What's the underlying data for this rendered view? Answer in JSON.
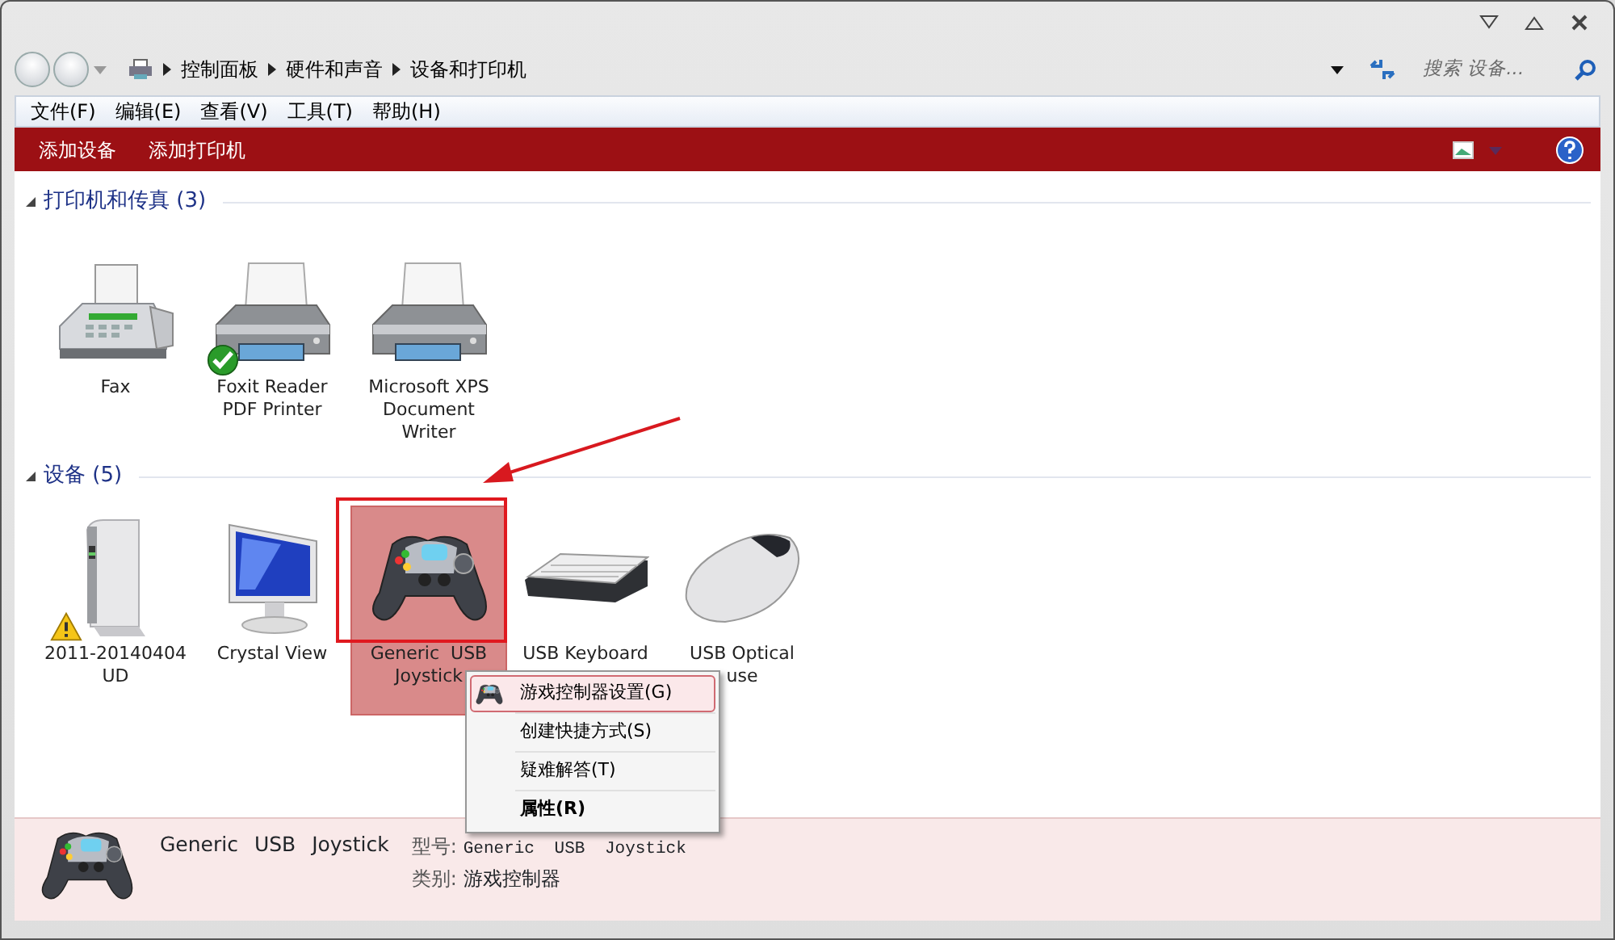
{
  "address": {
    "breadcrumb": [
      "控制面板",
      "硬件和声音",
      "设备和打印机"
    ]
  },
  "search": {
    "placeholder": "搜索 设备..."
  },
  "menu_bar": [
    "文件(F)",
    "编辑(E)",
    "查看(V)",
    "工具(T)",
    "帮助(H)"
  ],
  "command_bar": [
    "添加设备",
    "添加打印机"
  ],
  "groups": [
    {
      "title": "打印机和传真 (3)",
      "expanded": true,
      "items": [
        {
          "kind": "fax",
          "label_lines": [
            "Fax"
          ],
          "selected": false,
          "is_default": false,
          "has_problem": false
        },
        {
          "kind": "printer",
          "label_lines": [
            "Foxit Reader",
            "PDF Printer"
          ],
          "selected": false,
          "is_default": true,
          "has_problem": false
        },
        {
          "kind": "printer",
          "label_lines": [
            "Microsoft XPS",
            "Document",
            "Writer"
          ],
          "selected": false,
          "is_default": false,
          "has_problem": false
        }
      ]
    },
    {
      "title": "设备 (5)",
      "expanded": true,
      "items": [
        {
          "kind": "drive",
          "label_lines": [
            "2011-20140404",
            "UD"
          ],
          "selected": false,
          "is_default": false,
          "has_problem": true
        },
        {
          "kind": "monitor",
          "label_lines": [
            "Crystal View"
          ],
          "selected": false,
          "is_default": false,
          "has_problem": false
        },
        {
          "kind": "gamepad",
          "label_lines": [
            "Generic  USB",
            "Joystick"
          ],
          "selected": true,
          "is_default": false,
          "has_problem": false
        },
        {
          "kind": "keyboard",
          "label_lines": [
            "USB Keyboard"
          ],
          "selected": false,
          "is_default": false,
          "has_problem": false
        },
        {
          "kind": "mouse",
          "label_lines": [
            "USB Optical",
            "use"
          ],
          "selected": false,
          "is_default": false,
          "has_problem": false
        }
      ]
    }
  ],
  "context_menu": {
    "items": [
      {
        "kind": "with_icon",
        "label": "游戏控制器设置(G)",
        "highlighted": true,
        "default": false
      },
      {
        "kind": "plain",
        "label": "创建快捷方式(S)",
        "highlighted": false,
        "default": false
      },
      {
        "kind": "plain",
        "label": "疑难解答(T)",
        "highlighted": false,
        "default": false
      },
      {
        "kind": "plain",
        "label": "属性(R)",
        "highlighted": false,
        "default": true
      }
    ]
  },
  "details": {
    "name": "Generic USB Joystick",
    "fields": [
      {
        "label": "型号:",
        "value": "Generic USB Joystick",
        "kind": "mono"
      },
      {
        "label": "类别:",
        "value": "游戏控制器",
        "kind": "plain"
      }
    ]
  }
}
